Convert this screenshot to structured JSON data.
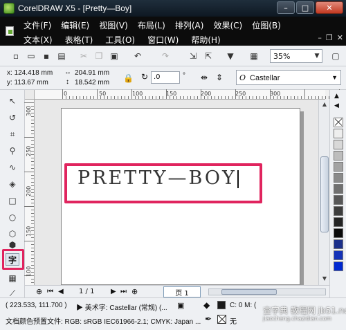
{
  "window": {
    "title": "CorelDRAW X5 - [Pretty—Boy]",
    "controls": {
      "minimize": "–",
      "maximize": "□",
      "close": "✕"
    }
  },
  "menu": {
    "row1": [
      "文件(F)",
      "编辑(E)",
      "视图(V)",
      "布局(L)",
      "排列(A)",
      "效果(C)",
      "位图(B)"
    ],
    "row2": [
      "文本(X)",
      "表格(T)",
      "工具(O)",
      "窗口(W)",
      "帮助(H)"
    ],
    "doc_controls": {
      "minimize": "–",
      "restore": "❐",
      "close": "✕"
    }
  },
  "toolbar": {
    "zoom": "35%"
  },
  "property_bar": {
    "x": "x: 124.418 mm",
    "y": "y: 113.67 mm",
    "width": "204.91 mm",
    "height": "18.542 mm",
    "angle": ".0",
    "degree_symbol": "°",
    "font": "Castellar"
  },
  "rulers": {
    "h_labels": [
      "0",
      "50",
      "100",
      "150",
      "200",
      "250",
      "300"
    ],
    "v_labels": [
      "300",
      "250",
      "200",
      "150",
      "100"
    ],
    "corner_icon": "ruler-corner"
  },
  "canvas": {
    "text": "PRETTY—BOY"
  },
  "pagebar": {
    "page_count": "1 / 1",
    "page_tab": "页 1"
  },
  "status": {
    "cursor": "( 223.533, 111.700 )",
    "object": "▶ 美术字: Castellar (常规) (...",
    "fill": "C: 0 M: (",
    "color_profile": "文档颜色预置文件: RGB: sRGB IEC61966-2.1; CMYK: Japan ...",
    "outline": "无"
  },
  "watermark": {
    "text": "查字典 教程网 jb51.net",
    "sub": "jiaocheng.chazidian.com"
  },
  "palette_colors": [
    "#ffffff",
    "#eeeeee",
    "#d8d8d8",
    "#bdbdbd",
    "#a3a3a3",
    "#8a8a8a",
    "#707070",
    "#575757",
    "#3d3d3d",
    "#242424",
    "#0a0a0a",
    "#1b2f8a",
    "#1432b8",
    "#0028d0"
  ]
}
